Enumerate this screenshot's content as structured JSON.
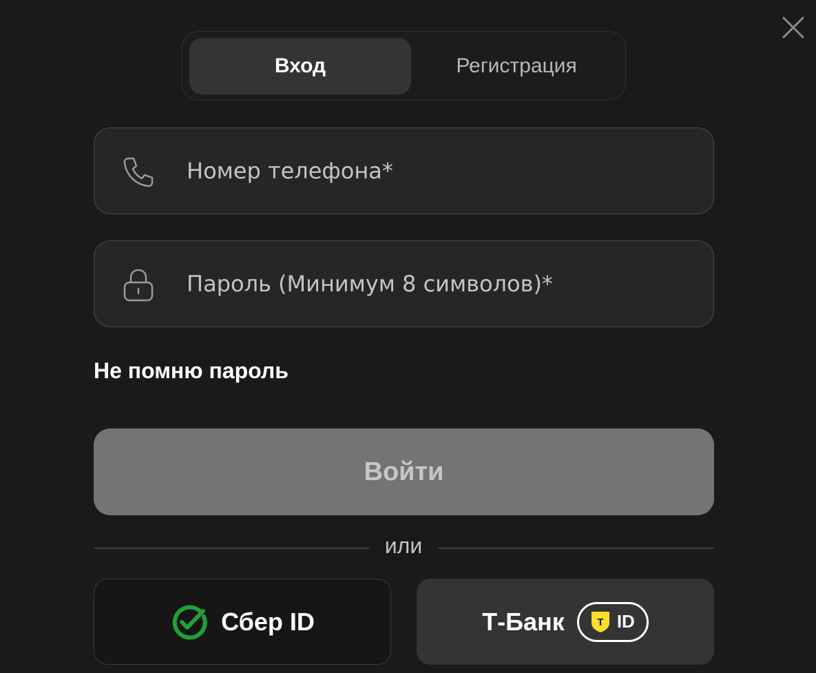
{
  "tabs": [
    {
      "label": "Вход",
      "active": true
    },
    {
      "label": "Регистрация",
      "active": false
    }
  ],
  "phone_field": {
    "placeholder": "Номер телефона*",
    "value": "",
    "icon": "phone-icon"
  },
  "password_field": {
    "placeholder": "Пароль (Минимум 8 символов)*",
    "value": "",
    "icon": "lock-icon"
  },
  "forgot_password": "Не помню пароль",
  "submit": {
    "label": "Войти",
    "enabled": false
  },
  "divider": "или",
  "social": {
    "sber": {
      "label": "Сбер ID",
      "icon": "sber-logo-icon",
      "color": "#21a038"
    },
    "tbank": {
      "label": "Т-Банк",
      "badge_letter": "T",
      "badge_text": "ID",
      "badge_color": "#ffdd2d"
    }
  },
  "colors": {
    "background": "#1a1a1a",
    "field_bg": "#262626",
    "button_disabled": "#747474"
  }
}
